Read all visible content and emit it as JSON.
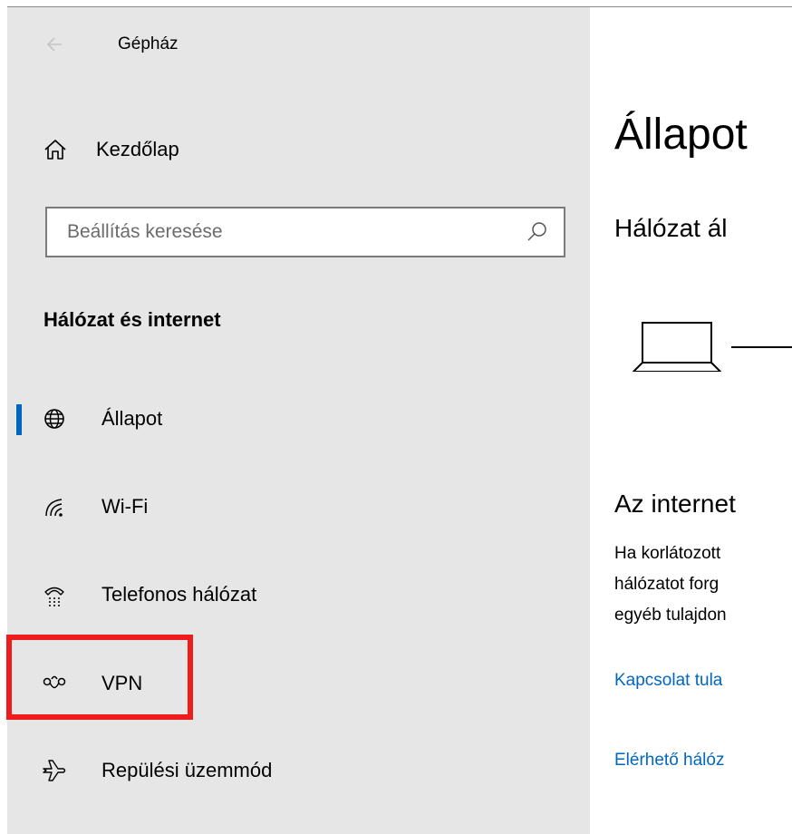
{
  "window": {
    "title": "Gépház"
  },
  "sidebar": {
    "home_label": "Kezdőlap",
    "search": {
      "placeholder": "Beállítás keresése"
    },
    "section_title": "Hálózat és internet",
    "items": [
      {
        "label": "Állapot",
        "icon": "globe-icon",
        "selected": true
      },
      {
        "label": "Wi-Fi",
        "icon": "wifi-icon",
        "selected": false
      },
      {
        "label": "Telefonos hálózat",
        "icon": "dialup-icon",
        "selected": false
      },
      {
        "label": "VPN",
        "icon": "vpn-icon",
        "selected": false
      },
      {
        "label": "Repülési üzemmód",
        "icon": "airplane-icon",
        "selected": false
      }
    ]
  },
  "main": {
    "title": "Állapot",
    "network_status_heading": "Hálózat ál",
    "internet_heading": "Az internet",
    "description_lines": [
      "Ha korlátozott",
      "hálózatot forg",
      "egyéb tulajdon"
    ],
    "links": [
      "Kapcsolat tula",
      "Elérhető hálóz"
    ]
  },
  "colors": {
    "accent": "#0067c0",
    "sidebar_bg": "#e6e6e6",
    "highlight_box": "#ee1c1c"
  }
}
